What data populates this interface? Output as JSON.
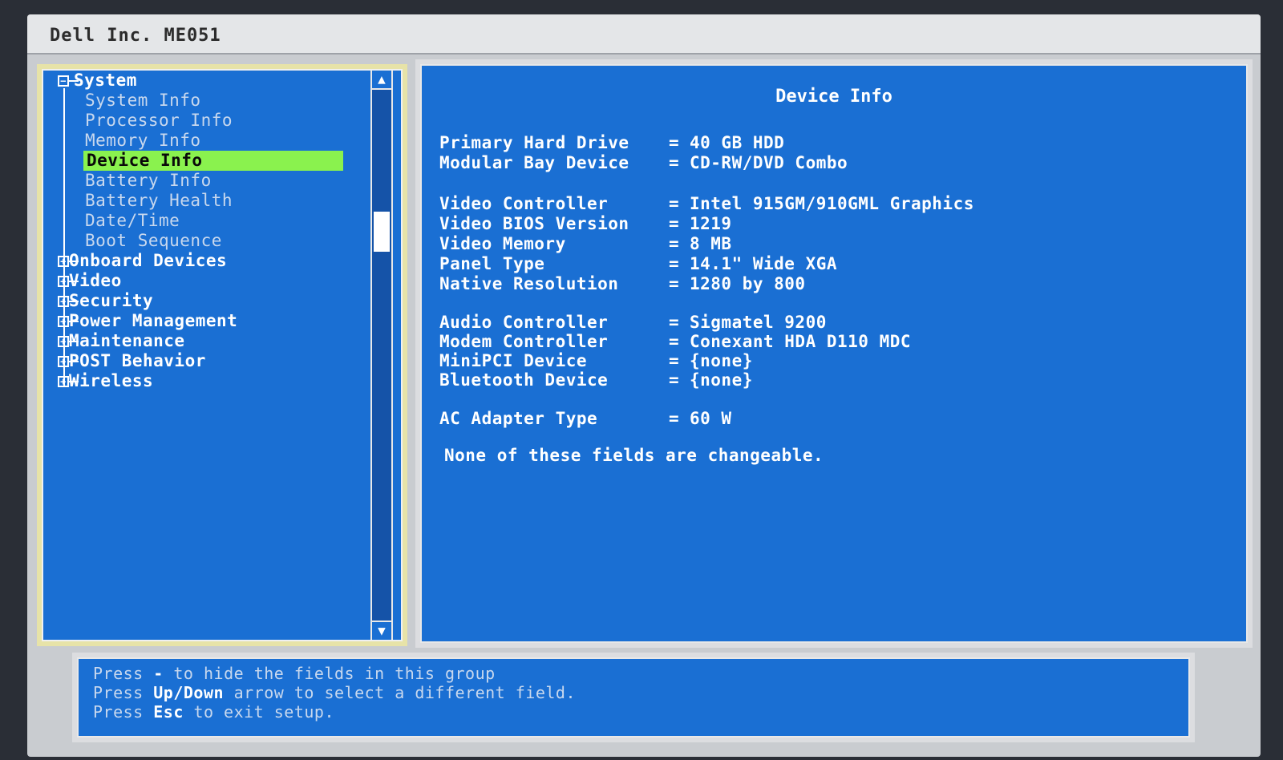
{
  "window": {
    "title": "Dell Inc. ME051"
  },
  "tree": {
    "system_label": "System",
    "children": [
      {
        "label": "System Info"
      },
      {
        "label": "Processor Info"
      },
      {
        "label": "Memory Info"
      },
      {
        "label": "Device Info",
        "selected": true
      },
      {
        "label": "Battery Info"
      },
      {
        "label": "Battery Health"
      },
      {
        "label": "Date/Time"
      },
      {
        "label": "Boot Sequence"
      }
    ],
    "groups": [
      {
        "label": "Onboard Devices"
      },
      {
        "label": "Video"
      },
      {
        "label": "Security"
      },
      {
        "label": "Power Management"
      },
      {
        "label": "Maintenance"
      },
      {
        "label": "POST Behavior"
      },
      {
        "label": "Wireless"
      }
    ]
  },
  "panel": {
    "title": "Device Info",
    "fields": [
      {
        "label": "Primary Hard Drive",
        "value": "40 GB HDD"
      },
      {
        "label": "Modular Bay Device",
        "value": "CD-RW/DVD Combo"
      },
      {
        "label": "Video Controller",
        "value": "Intel 915GM/910GML Graphics"
      },
      {
        "label": "Video BIOS Version",
        "value": "1219"
      },
      {
        "label": "Video Memory",
        "value": "8 MB"
      },
      {
        "label": "Panel Type",
        "value": "14.1\" Wide XGA"
      },
      {
        "label": "Native Resolution",
        "value": "1280 by 800"
      },
      {
        "label": "Audio Controller",
        "value": "Sigmatel 9200"
      },
      {
        "label": "Modem Controller",
        "value": "Conexant HDA D110 MDC"
      },
      {
        "label": "MiniPCI Device",
        "value": "{none}"
      },
      {
        "label": "Bluetooth Device",
        "value": "{none}"
      },
      {
        "label": "AC Adapter Type",
        "value": "60 W"
      }
    ],
    "note": "None of these fields are changeable."
  },
  "help": {
    "line1_pre": "Press",
    "line1_key": "-",
    "line1_post": "to hide the fields in this group",
    "line2_pre": "Press",
    "line2_key": "Up/Down",
    "line2_post": "arrow to select a different field.",
    "line3_pre": "Press",
    "line3_key": "Esc",
    "line3_post": "to exit setup."
  },
  "icons": {
    "collapse": "minus-box-icon",
    "expand": "plus-box-icon",
    "scroll_up": "arrow-up-icon",
    "scroll_down": "arrow-down-icon"
  },
  "colors": {
    "panel_blue": "#1a6fd3",
    "selection_green": "#8af24e"
  }
}
